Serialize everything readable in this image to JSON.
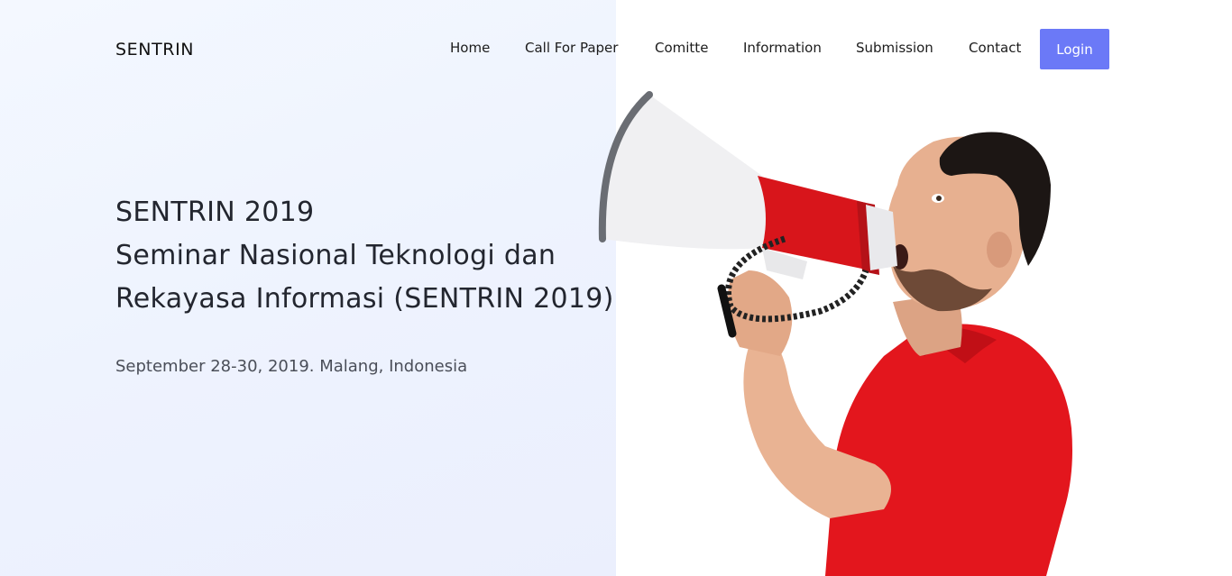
{
  "brand": "SENTRIN",
  "nav": {
    "items": [
      {
        "label": "Home"
      },
      {
        "label": "Call For Paper"
      },
      {
        "label": "Comitte"
      },
      {
        "label": "Information"
      },
      {
        "label": "Submission"
      },
      {
        "label": "Contact"
      }
    ],
    "login_label": "Login"
  },
  "hero": {
    "title_line1": "SENTRIN 2019",
    "title_line2": "Seminar Nasional Teknologi dan",
    "title_line3": "Rekayasa Informasi (SENTRIN 2019)",
    "date_location": "September 28-30, 2019. Malang, Indonesia"
  },
  "colors": {
    "accent": "#6b79f7",
    "left_panel_bg": "#eef3fe",
    "shirt_red": "#e3161d",
    "megaphone_red": "#d8151b"
  }
}
